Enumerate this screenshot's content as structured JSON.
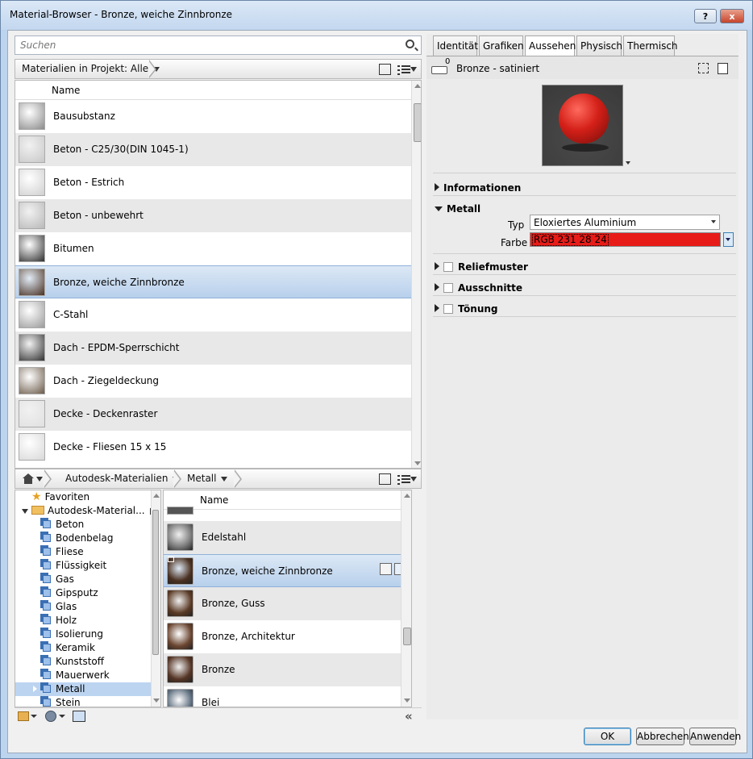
{
  "window": {
    "title": "Material-Browser - Bronze, weiche Zinnbronze",
    "help_label": "?",
    "close_label": "x"
  },
  "search": {
    "placeholder": "Suchen"
  },
  "project_bar": {
    "filter_label": "Materialien in Projekt: Alle"
  },
  "project_list": {
    "column_header": "Name",
    "items": [
      {
        "label": "Bausubstanz",
        "swatch": "#8a8a8a"
      },
      {
        "label": "Beton - C25/30(DIN 1045-1)",
        "swatch": "#c8c8c8"
      },
      {
        "label": "Beton - Estrich",
        "swatch": "#cfcfcf"
      },
      {
        "label": "Beton - unbewehrt",
        "swatch": "#b8b8b8"
      },
      {
        "label": "Bitumen",
        "swatch": "#2e2e2e"
      },
      {
        "label": "Bronze, weiche Zinnbronze",
        "swatch": "#4a3020",
        "selected": true
      },
      {
        "label": "C-Stahl",
        "swatch": "#9a9a9a"
      },
      {
        "label": "Dach - EPDM-Sperrschicht",
        "swatch": "#303030"
      },
      {
        "label": "Dach - Ziegeldeckung",
        "swatch": "#6b5a48"
      },
      {
        "label": "Decke - Deckenraster",
        "swatch": "#e0e0e0"
      },
      {
        "label": "Decke - Fliesen 15 x 15",
        "swatch": "#d8d8d8"
      }
    ]
  },
  "library_bar": {
    "home_icon": "home-icon",
    "crumb1": "Autodesk-Materialien",
    "crumb2": "Metall"
  },
  "tree": {
    "favorites": "Favoriten",
    "root": "Autodesk-Material...",
    "children": [
      "Beton",
      "Bodenbelag",
      "Fliese",
      "Flüssigkeit",
      "Gas",
      "Gipsputz",
      "Glas",
      "Holz",
      "Isolierung",
      "Keramik",
      "Kunststoff",
      "Mauerwerk",
      "Metall",
      "Stein"
    ],
    "selected": "Metall"
  },
  "library_list": {
    "column_header": "Name",
    "items": [
      {
        "label": "Edelstahl",
        "swatch": "#7a7a7a"
      },
      {
        "label": "Bronze, weiche Zinnbronze",
        "swatch": "#4a3020",
        "selected": true
      },
      {
        "label": "Bronze, Guss",
        "swatch": "#5a3a25"
      },
      {
        "label": "Bronze, Architektur",
        "swatch": "#6a4530"
      },
      {
        "label": "Bronze",
        "swatch": "#553525"
      },
      {
        "label": "Blei",
        "swatch": "#607080"
      }
    ]
  },
  "tabs": [
    "Identität",
    "Grafiken",
    "Aussehen",
    "Physisch",
    "Thermisch"
  ],
  "active_tab": "Aussehen",
  "asset": {
    "name": "Bronze - satiniert",
    "count": "0"
  },
  "sections": {
    "info": "Informationen",
    "metal": "Metall",
    "type_label": "Typ",
    "type_value": "Eloxiertes Aluminium",
    "color_label": "Farbe",
    "color_value": "RGB 231 28 24",
    "color_hex": "#e71c18",
    "relief": "Reliefmuster",
    "cutouts": "Ausschnitte",
    "tint": "Tönung"
  },
  "buttons": {
    "ok": "OK",
    "cancel": "Abbrechen",
    "apply": "Anwenden"
  }
}
